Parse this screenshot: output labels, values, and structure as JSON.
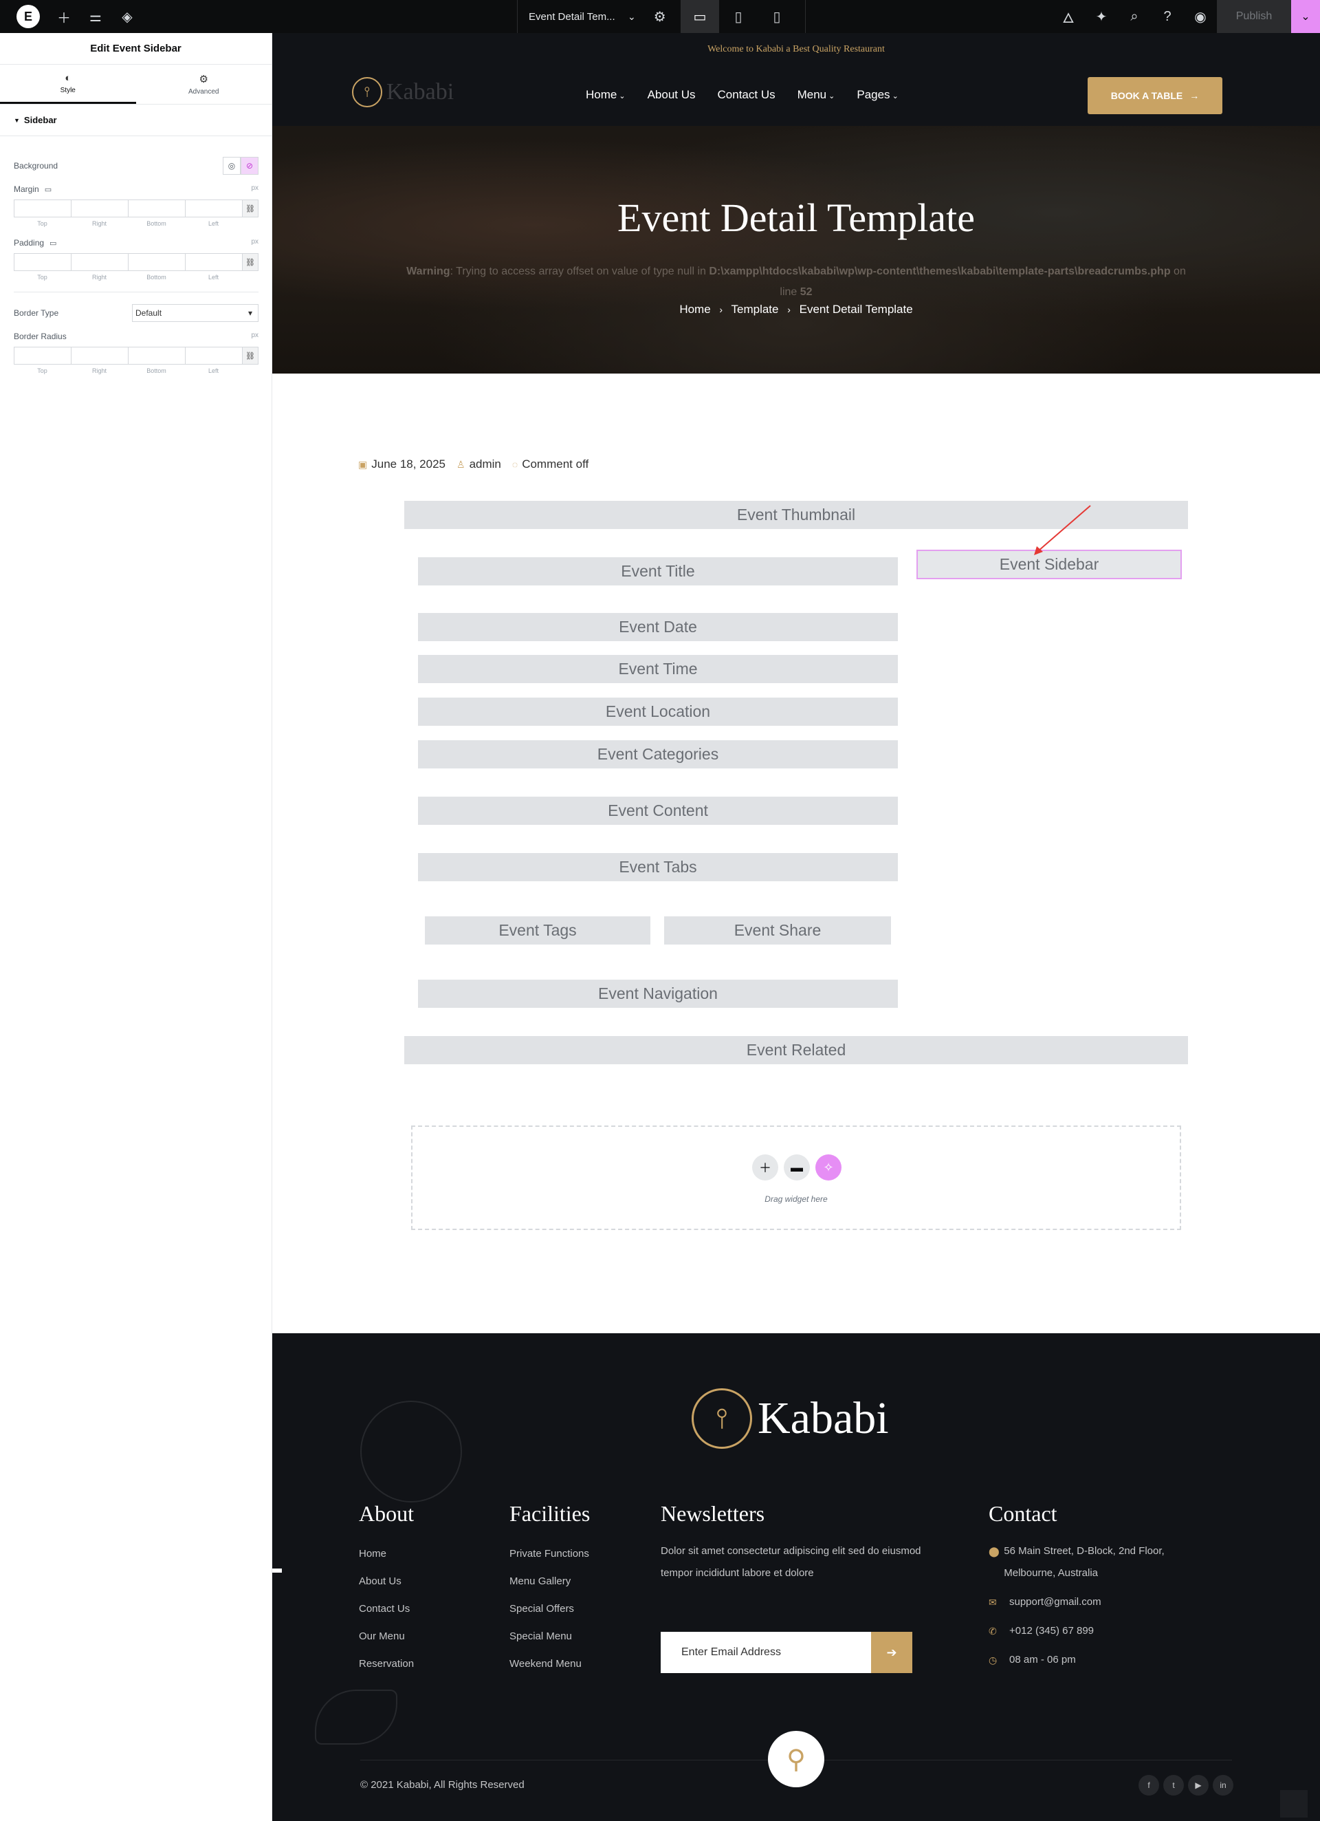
{
  "topbar": {
    "logo": "E",
    "doc_title": "Event Detail Tem...",
    "publish_label": "Publish"
  },
  "panel": {
    "title": "Edit Event Sidebar",
    "tabs": [
      {
        "label": "Style",
        "icon": "◐"
      },
      {
        "label": "Advanced",
        "icon": "⚙"
      }
    ],
    "section": "Sidebar",
    "background_label": "Background",
    "margin_label": "Margin",
    "padding_label": "Padding",
    "border_type_label": "Border Type",
    "border_type_value": "Default",
    "border_radius_label": "Border Radius",
    "unit": "px",
    "dim_labels": [
      "Top",
      "Right",
      "Bottom",
      "Left"
    ]
  },
  "header": {
    "welcome": "Welcome to Kababi a Best Quality Restaurant",
    "logo_text": "Kababi",
    "nav": [
      {
        "label": "Home",
        "has_caret": true
      },
      {
        "label": "About Us",
        "has_caret": false
      },
      {
        "label": "Contact Us",
        "has_caret": false
      },
      {
        "label": "Menu",
        "has_caret": true
      },
      {
        "label": "Pages",
        "has_caret": true
      }
    ],
    "book_label": "BOOK A TABLE"
  },
  "hero": {
    "title": "Event Detail Template",
    "warning_prefix": "Warning",
    "warning_mid": ": Trying to access array offset on value of type null in ",
    "warning_path": "D:\\xampp\\htdocs\\kababi\\wp\\wp-content\\themes\\kababi\\template-parts\\breadcrumbs.php",
    "warning_on": " on",
    "warning_line": "line ",
    "warning_line_num": "52",
    "breadcrumbs": [
      "Home",
      "Template",
      "Event Detail Template"
    ]
  },
  "meta": {
    "date": "June 18, 2025",
    "author": "admin",
    "comment": "Comment off"
  },
  "widgets": {
    "thumbnail": "Event Thumbnail",
    "title": "Event Title",
    "sidebar": "Event Sidebar",
    "date": "Event Date",
    "time": "Event Time",
    "location": "Event Location",
    "categories": "Event Categories",
    "content": "Event Content",
    "tabs": "Event Tabs",
    "tags": "Event Tags",
    "share": "Event Share",
    "navigation": "Event Navigation",
    "related": "Event Related"
  },
  "dropzone": {
    "text": "Drag widget here"
  },
  "footer": {
    "logo_text": "Kababi",
    "about": {
      "title": "About",
      "links": [
        "Home",
        "About Us",
        "Contact Us",
        "Our Menu",
        "Reservation"
      ]
    },
    "facilities": {
      "title": "Facilities",
      "links": [
        "Private Functions",
        "Menu Gallery",
        "Special Offers",
        "Special Menu",
        "Weekend Menu"
      ]
    },
    "newsletters": {
      "title": "Newsletters",
      "text": "Dolor sit amet consectetur adipiscing elit sed do eiusmod tempor incididunt labore et dolore",
      "placeholder": "Enter Email Address"
    },
    "contact": {
      "title": "Contact",
      "address": "56 Main Street, D-Block, 2nd Floor, Melbourne, Australia",
      "email": "support@gmail.com",
      "phone": "+012 (345) 67 899",
      "hours": "08 am - 06 pm"
    },
    "copyright": "© 2021 Kababi, All Rights Reserved",
    "socials": [
      "facebook-icon",
      "twitter-icon",
      "youtube-icon",
      "linkedin-icon"
    ]
  },
  "colors": {
    "accent": "#c9a364",
    "editor_accent": "#e68ef5",
    "dark": "#111317",
    "widget_bg": "#e0e2e5"
  }
}
